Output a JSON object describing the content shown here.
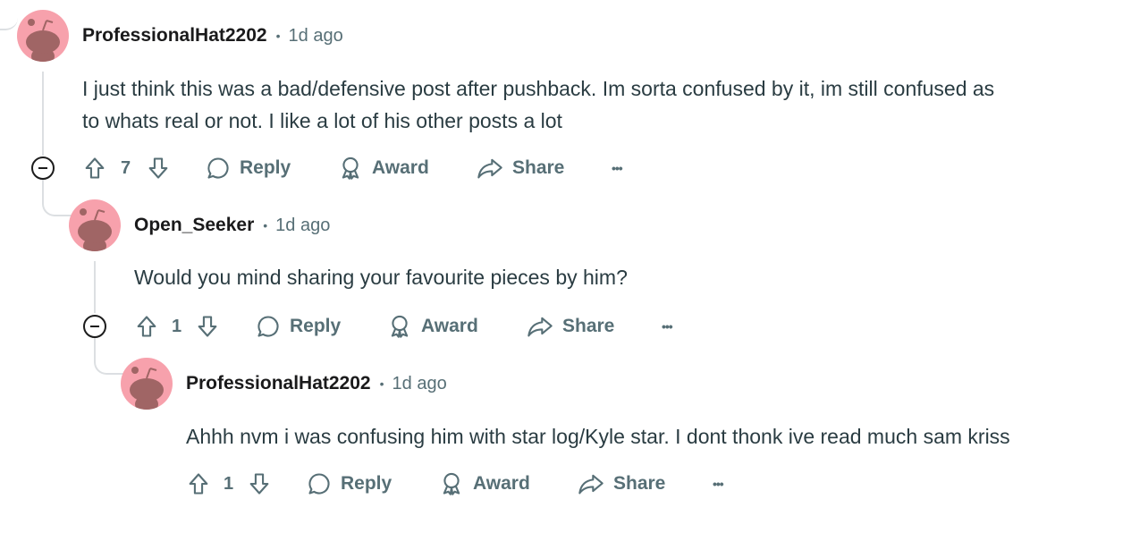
{
  "comments": [
    {
      "author": "ProfessionalHat2202",
      "time": "1d ago",
      "body_lines": [
        "I just think this was a bad/defensive post after pushback. Im sorta confused by it, im still confused as",
        "to whats real or not. I like a lot of his other posts a lot"
      ],
      "score": "7"
    },
    {
      "author": "Open_Seeker",
      "time": "1d ago",
      "body_lines": [
        "Would you mind sharing your favourite pieces by him?"
      ],
      "score": "1"
    },
    {
      "author": "ProfessionalHat2202",
      "time": "1d ago",
      "body_lines": [
        "Ahhh nvm i was confusing him with star log/Kyle star. I dont thonk ive read much sam kriss"
      ],
      "score": "1"
    }
  ],
  "actions": {
    "separator": "•",
    "reply": "Reply",
    "award": "Award",
    "share": "Share",
    "more": "•••"
  },
  "icons": {
    "upvote": "arrow-up-icon",
    "downvote": "arrow-down-icon",
    "reply": "speech-bubble-icon",
    "award": "award-ribbon-icon",
    "share": "share-arrow-icon",
    "more": "more-dots-icon",
    "collapse": "collapse-minus-icon",
    "avatar": "snoo-avatar-icon"
  },
  "colors": {
    "avatar_bg": "#f7a1ac",
    "snoo": "#a06565",
    "meta_gray": "#576f76",
    "thread_line": "#dcdfe2"
  }
}
